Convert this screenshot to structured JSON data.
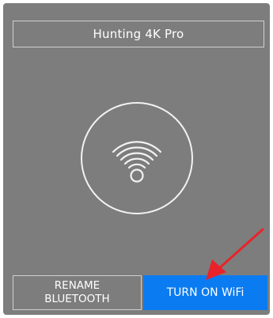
{
  "device": {
    "title": "Hunting 4K Pro"
  },
  "center": {
    "icon": "wifi-icon"
  },
  "buttons": {
    "rename_line1": "RENAME",
    "rename_line2": "BLUETOOTH",
    "turn_on_wifi": "TURN ON WiFi"
  },
  "annotation": {
    "icon": "red-arrow-icon",
    "color": "#e8242a"
  },
  "colors": {
    "panel_bg": "#7d7d7d",
    "accent_blue": "#0a7bf1",
    "text": "#ffffff"
  }
}
